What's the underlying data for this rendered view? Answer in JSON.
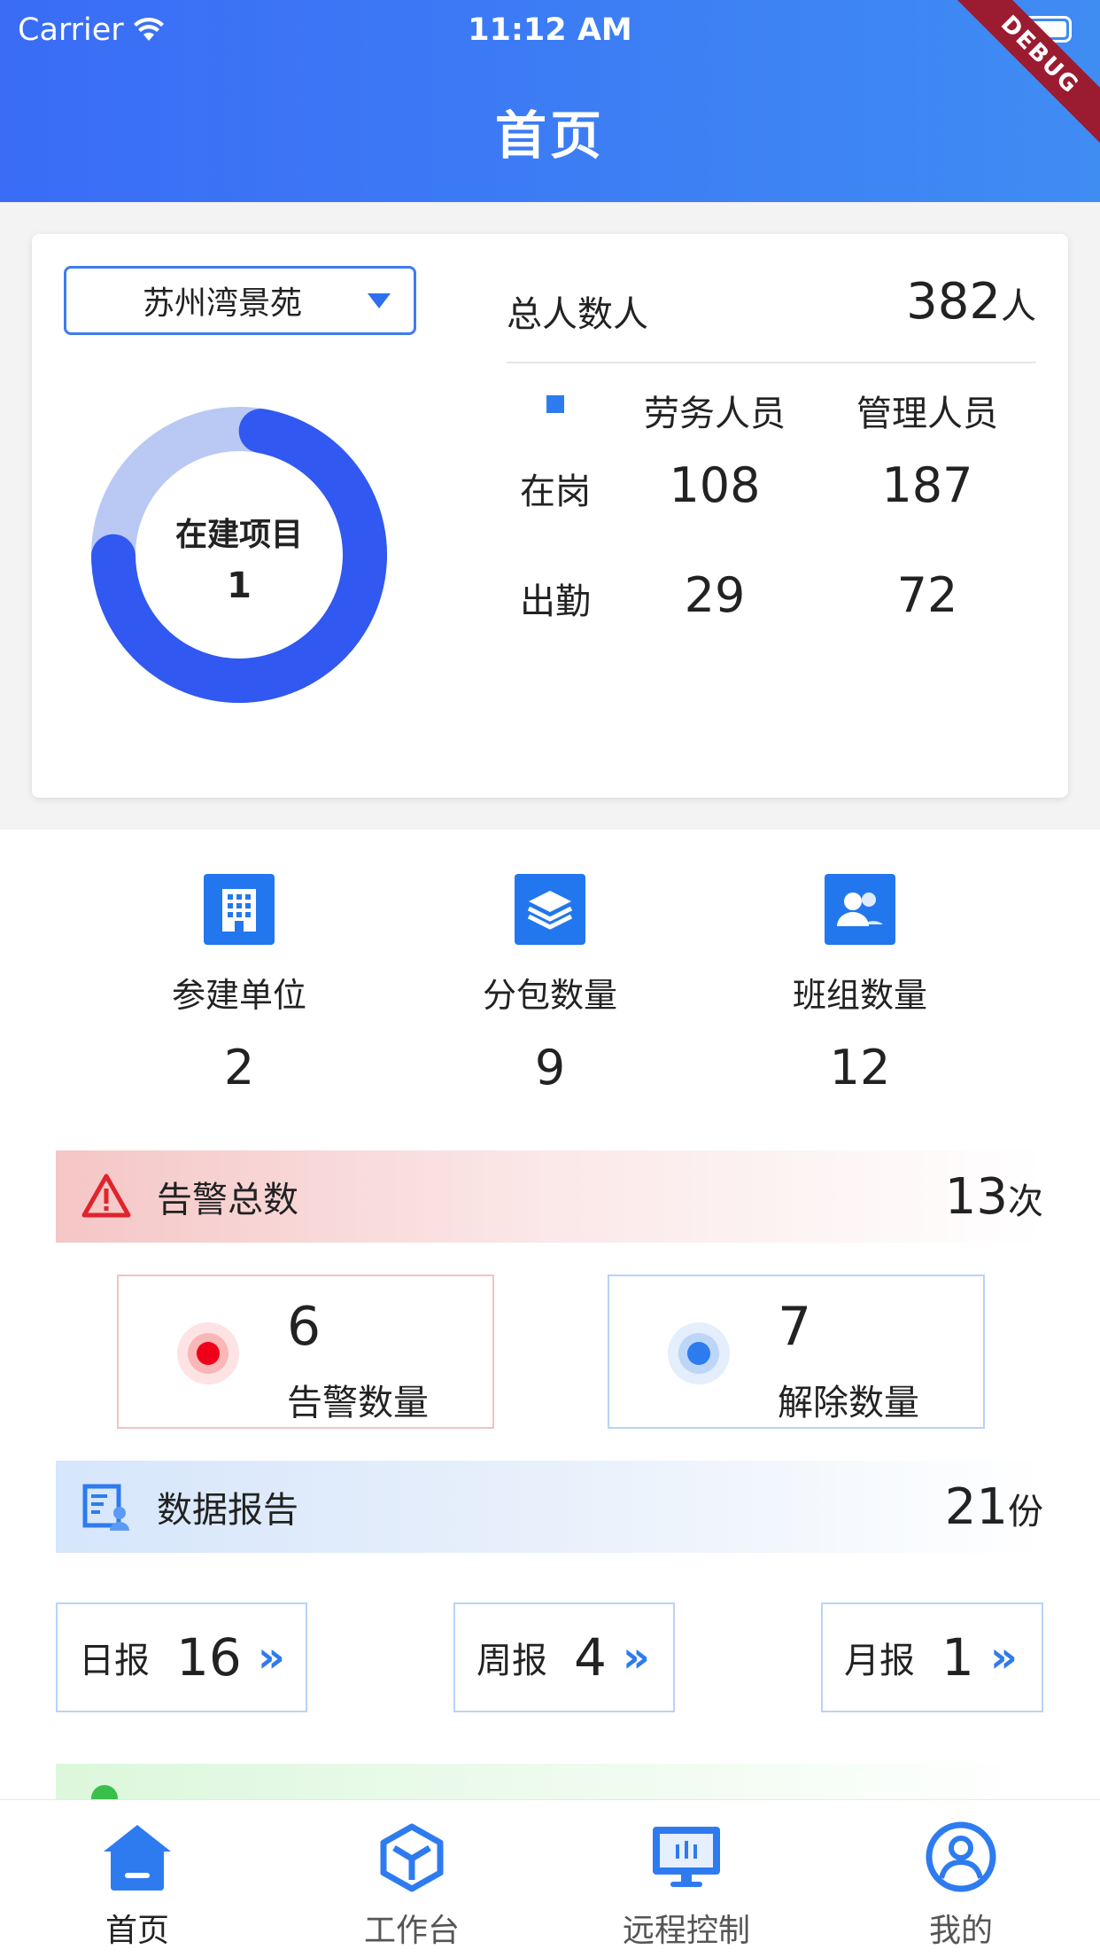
{
  "status_bar": {
    "carrier": "Carrier",
    "time": "11:12 AM"
  },
  "header": {
    "title": "首页",
    "debug_banner": "DEBUG"
  },
  "project_card": {
    "selected_project": "苏州湾景苑",
    "donut": {
      "label": "在建项目",
      "value": "1",
      "progress": 0.72,
      "colors": {
        "track": "#b9c9f4",
        "fill": "#3158f0"
      }
    },
    "total": {
      "label": "总人数人",
      "value": "382",
      "unit": "人"
    },
    "table": {
      "headers": [
        "劳务人员",
        "管理人员"
      ],
      "rows": [
        {
          "label": "在岗",
          "values": [
            "108",
            "187"
          ]
        },
        {
          "label": "出勤",
          "values": [
            "29",
            "72"
          ]
        }
      ]
    }
  },
  "metrics": [
    {
      "icon": "building-icon",
      "label": "参建单位",
      "value": "2"
    },
    {
      "icon": "layers-icon",
      "label": "分包数量",
      "value": "9"
    },
    {
      "icon": "group-icon",
      "label": "班组数量",
      "value": "12"
    }
  ],
  "alarm": {
    "label": "告警总数",
    "count": "13",
    "unit": "次",
    "alert": {
      "value": "6",
      "label": "告警数量",
      "color": "#f00018"
    },
    "cleared": {
      "value": "7",
      "label": "解除数量",
      "color": "#2e7bf0"
    }
  },
  "report": {
    "label": "数据报告",
    "count": "21",
    "unit": "份",
    "daily": {
      "label": "日报",
      "value": "16"
    },
    "weekly": {
      "label": "周报",
      "value": "4"
    },
    "monthly": {
      "label": "月报",
      "value": "1"
    },
    "chevron": "»"
  },
  "tabbar": [
    {
      "label": "首页",
      "icon": "home-icon",
      "active": true
    },
    {
      "label": "工作台",
      "icon": "cube-icon"
    },
    {
      "label": "远程控制",
      "icon": "monitor-icon"
    },
    {
      "label": "我的",
      "icon": "profile-icon"
    }
  ]
}
